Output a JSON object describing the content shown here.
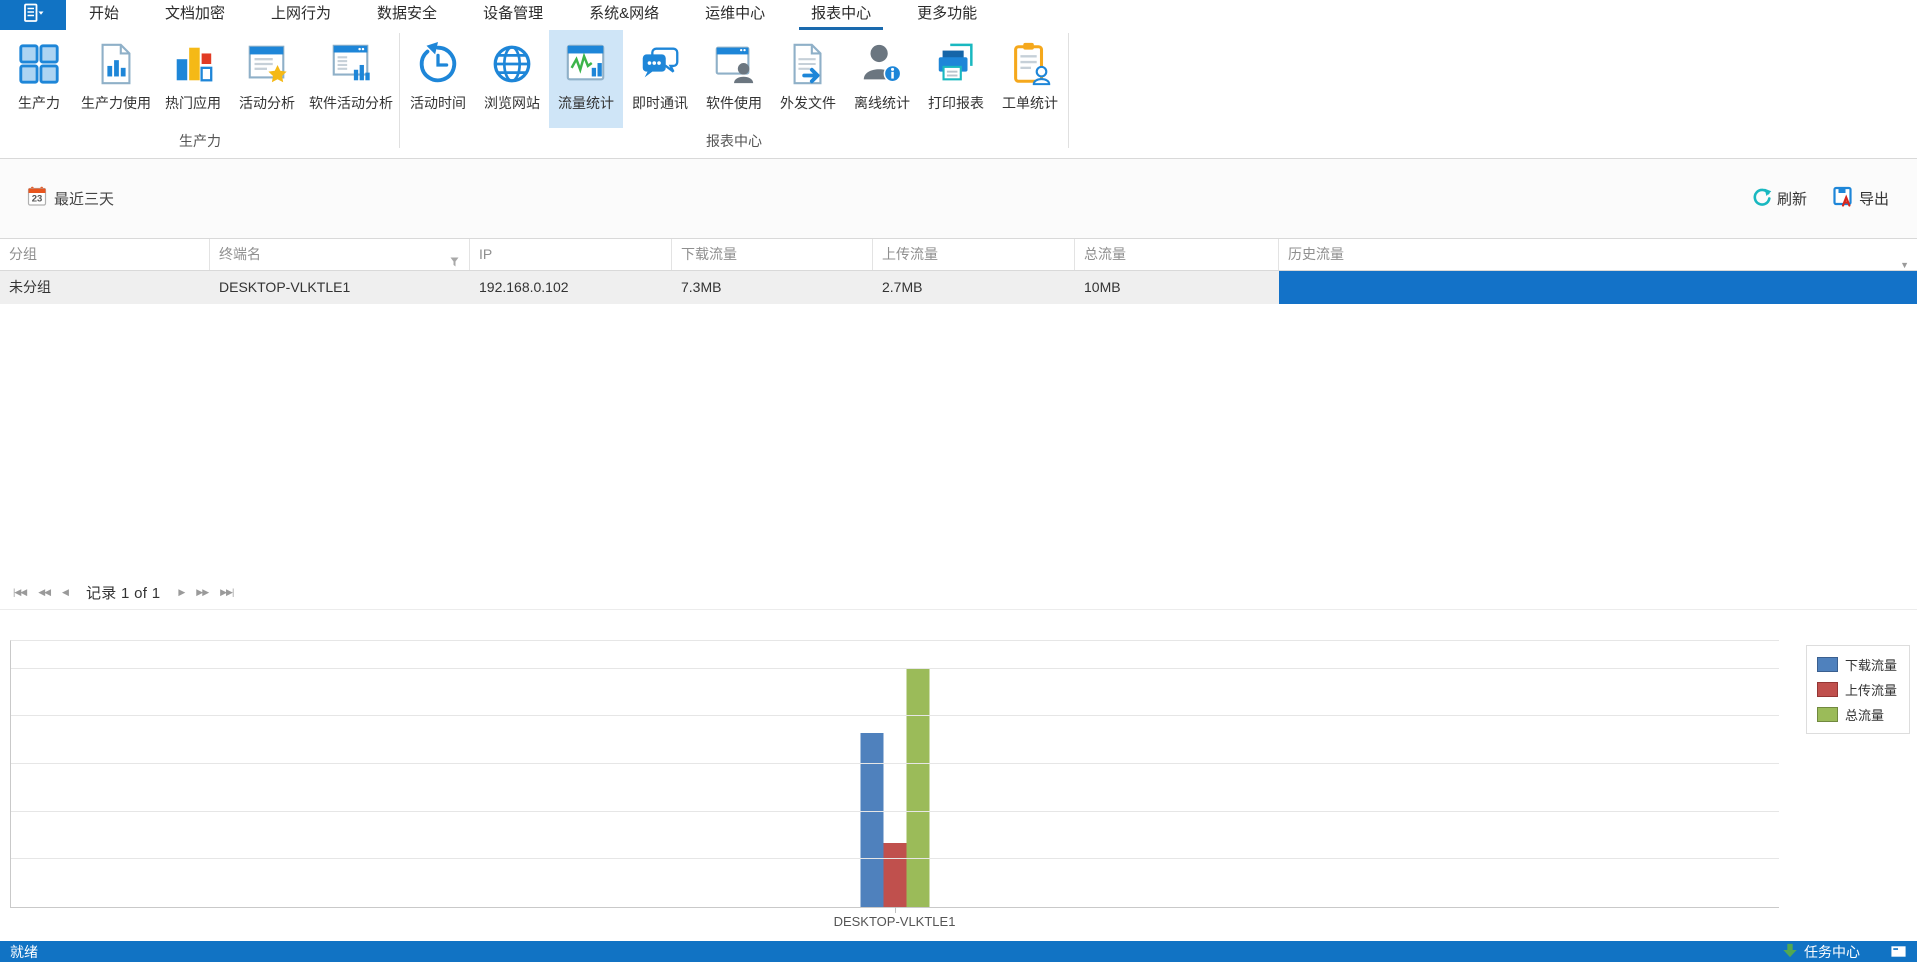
{
  "tabbar": {
    "tabs": [
      "开始",
      "文档加密",
      "上网行为",
      "数据安全",
      "设备管理",
      "系统&网络",
      "运维中心",
      "报表中心",
      "更多功能"
    ],
    "active_tab": "报表中心",
    "menu_icon": "app-menu-icon"
  },
  "ribbon": {
    "groups": [
      {
        "label": "生产力",
        "items": [
          {
            "label": "生产力",
            "icon": "grid-icon"
          },
          {
            "label": "生产力使用",
            "icon": "doc-chart-icon"
          },
          {
            "label": "热门应用",
            "icon": "hot-apps-bars-icon"
          },
          {
            "label": "活动分析",
            "icon": "doc-star-icon"
          },
          {
            "label": "软件活动分析",
            "icon": "window-chart-icon"
          }
        ]
      },
      {
        "label": "报表中心",
        "items": [
          {
            "label": "活动时间",
            "icon": "clock-history-icon"
          },
          {
            "label": "浏览网站",
            "icon": "globe-icon"
          },
          {
            "label": "流量统计",
            "icon": "traffic-stats-icon",
            "selected": true
          },
          {
            "label": "即时通讯",
            "icon": "chat-icon"
          },
          {
            "label": "软件使用",
            "icon": "window-user-icon"
          },
          {
            "label": "外发文件",
            "icon": "doc-arrow-icon"
          },
          {
            "label": "离线统计",
            "icon": "user-info-icon"
          },
          {
            "label": "打印报表",
            "icon": "printer-icon"
          },
          {
            "label": "工单统计",
            "icon": "clipboard-user-icon"
          }
        ]
      }
    ]
  },
  "toolbar": {
    "date_range_label": "最近三天",
    "calendar_day": "23",
    "refresh_label": "刷新",
    "export_label": "导出"
  },
  "table": {
    "columns": [
      {
        "label": "分组"
      },
      {
        "label": "终端名",
        "filter_icon": true
      },
      {
        "label": "IP"
      },
      {
        "label": "下载流量"
      },
      {
        "label": "上传流量"
      },
      {
        "label": "总流量"
      },
      {
        "label": "历史流量",
        "dropdown_icon": true
      }
    ],
    "rows": [
      [
        "未分组",
        "DESKTOP-VLKTLE1",
        "192.168.0.102",
        "7.3MB",
        "2.7MB",
        "10MB",
        ""
      ]
    ]
  },
  "pagination": {
    "record_text": "记录 1 of 1",
    "left_icons": [
      "first-page-icon",
      "fast-prev-icon",
      "prev-page-icon"
    ],
    "right_icons": [
      "next-page-icon",
      "fast-next-icon",
      "last-page-icon"
    ]
  },
  "chart_data": {
    "type": "bar",
    "categories": [
      "DESKTOP-VLKTLE1"
    ],
    "series": [
      {
        "name": "下载流量",
        "values": [
          7.3
        ],
        "color": "#4f81bd",
        "border": "#3a5f8f"
      },
      {
        "name": "上传流量",
        "values": [
          2.7
        ],
        "color": "#c0504d",
        "border": "#943634"
      },
      {
        "name": "总流量",
        "values": [
          10
        ],
        "color": "#9bbb59",
        "border": "#71893f"
      }
    ],
    "unit": "MB",
    "ylim": [
      0,
      11.2
    ],
    "grid_step": 2,
    "grid": true,
    "y_tick_labels": false,
    "legend_position": "top-right",
    "title": "",
    "xlabel": "",
    "ylabel": ""
  },
  "statusbar": {
    "left_text": "就绪",
    "task_center_label": "任务中心",
    "task_center_icon": "download-arrow-icon",
    "corner_icon": "window-icon"
  }
}
